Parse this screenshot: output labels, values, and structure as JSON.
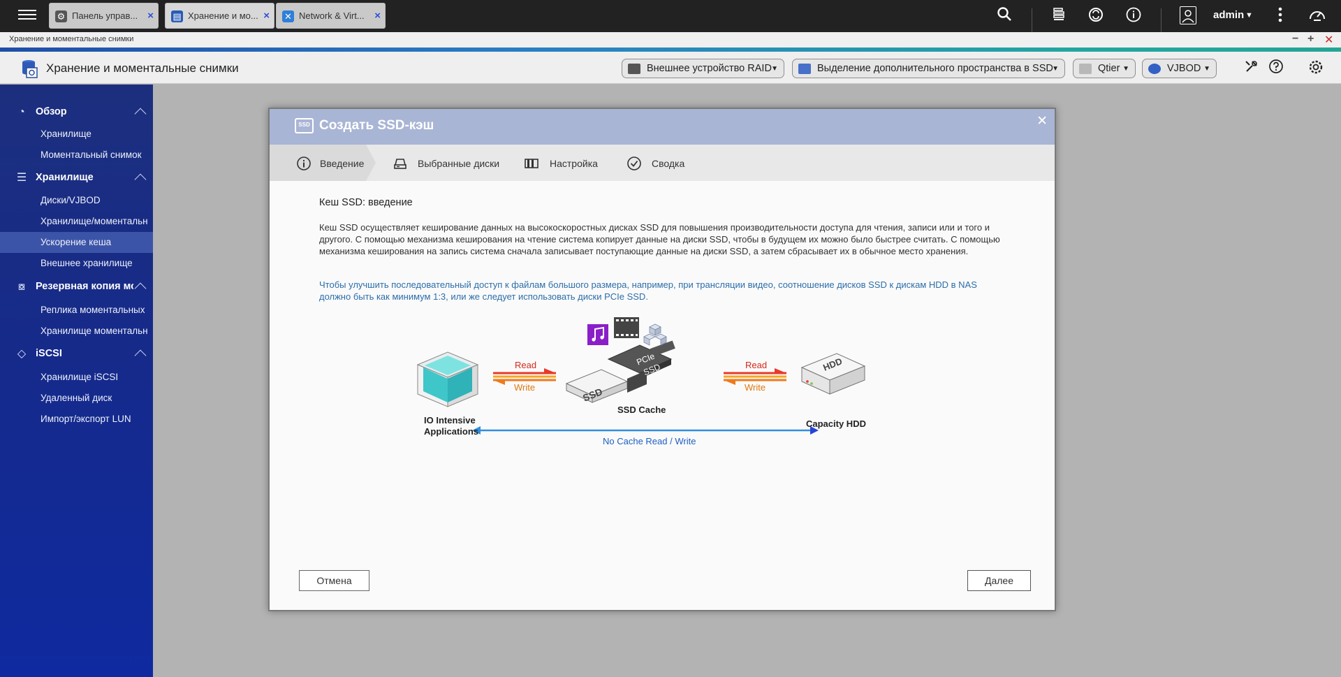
{
  "tabs": [
    {
      "title": "Панель управ...",
      "icon": "gear-icon"
    },
    {
      "title": "Хранение и мо...",
      "icon": "storage-icon"
    },
    {
      "title": "Network & Virt...",
      "icon": "network-icon"
    }
  ],
  "topbar": {
    "user": "admin",
    "icons": [
      "search-icon",
      "stack-icon",
      "sync-icon",
      "info-icon",
      "user-icon",
      "more-icon",
      "dashboard-icon"
    ]
  },
  "window": {
    "title": "Хранение и моментальные снимки",
    "controls": {
      "minimize": "−",
      "maximize": "+",
      "close": "✕"
    }
  },
  "app": {
    "title": "Хранение и моментальные снимки",
    "buttons": [
      {
        "label": "Внешнее устройство RAID"
      },
      {
        "label": "Выделение дополнительного пространства в SSD"
      },
      {
        "label": "Qtier"
      },
      {
        "label": "VJBOD"
      }
    ]
  },
  "sidebar": {
    "sections": [
      {
        "label": "Обзор",
        "items": [
          "Хранилище",
          "Моментальный снимок"
        ]
      },
      {
        "label": "Хранилище",
        "items": [
          "Диски/VJBOD",
          "Хранилище/моментальн",
          "Ускорение кеша",
          "Внешнее хранилище"
        ]
      },
      {
        "label": "Резервная копия мо",
        "items": [
          "Реплика моментальных",
          "Хранилище моментальн"
        ]
      },
      {
        "label": "iSCSI",
        "items": [
          "Хранилище iSCSI",
          "Удаленный диск",
          "Импорт/экспорт LUN"
        ]
      }
    ],
    "active_item": "Ускорение кеша"
  },
  "dialog": {
    "title": "Создать SSD-кэш",
    "icon_text": "SSD",
    "steps": [
      {
        "label": "Введение"
      },
      {
        "label": "Выбранные диски"
      },
      {
        "label": "Настройка"
      },
      {
        "label": "Сводка"
      }
    ],
    "heading": "Кеш SSD: введение",
    "paragraph1": "Кеш SSD осуществляет кеширование данных на высокоскоростных дисках SSD для повышения производительности доступа для чтения, записи или и того и другого. С помощью механизма кеширования на чтение система копирует данные на диски SSD, чтобы в будущем их можно было быстрее считать. С помощью механизма кеширования на запись система сначала записывает поступающие данные на диски SSD, а затем сбрасывает их в обычное место хранения.",
    "paragraph2": "Чтобы улучшить последовательный доступ к файлам большого размера, например, при трансляции видео, соотношение дисков SSD к дискам HDD в NAS должно быть как минимум 1:3, или же следует использовать диски PCIe SSD.",
    "diagram": {
      "read": "Read",
      "write": "Write",
      "apps_label_1": "IO Intensive",
      "apps_label_2": "Applications",
      "ssd_label": "SSD Cache",
      "hdd_label": "Capacity HDD",
      "nocache_label": "No Cache Read / Write",
      "ssd_text": "SSD",
      "pcie_text_1": "PCIe",
      "pcie_text_2": "SSD",
      "hdd_text": "HDD"
    },
    "cancel": "Отмена",
    "next": "Далее"
  }
}
